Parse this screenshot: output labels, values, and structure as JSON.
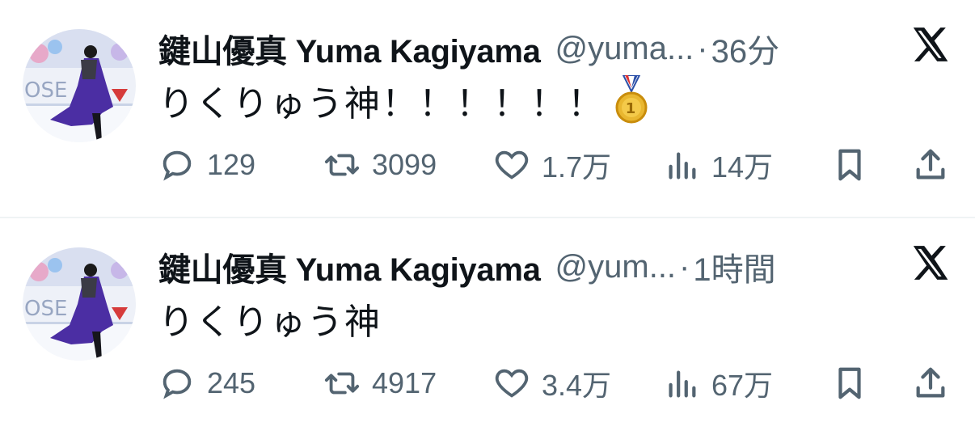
{
  "tweets": [
    {
      "name": "鍵山優真 Yuma Kagiyama",
      "handle": "@yuma...",
      "separator": "·",
      "time": "36分",
      "text": "りくりゅう神！！！！！！",
      "has_medal": true,
      "counts": {
        "replies": "129",
        "retweets": "3099",
        "likes": "1.7万",
        "views": "14万"
      }
    },
    {
      "name": "鍵山優真 Yuma Kagiyama",
      "handle": "@yum...",
      "separator": "·",
      "time": "1時間",
      "text": "りくりゅう神",
      "has_medal": false,
      "counts": {
        "replies": "245",
        "retweets": "4917",
        "likes": "3.4万",
        "views": "67万"
      }
    }
  ],
  "icons": {
    "reply": "reply-icon",
    "retweet": "retweet-icon",
    "like": "heart-icon",
    "views": "views-icon",
    "bookmark": "bookmark-icon",
    "share": "share-icon",
    "logo": "x-logo-icon",
    "medal": "gold-medal-icon"
  },
  "colors": {
    "text": "#0f1419",
    "muted": "#536471",
    "divider": "#eff3f4",
    "medal_gold": "#e9b730",
    "medal_ribbon": "#2b4fa8"
  }
}
